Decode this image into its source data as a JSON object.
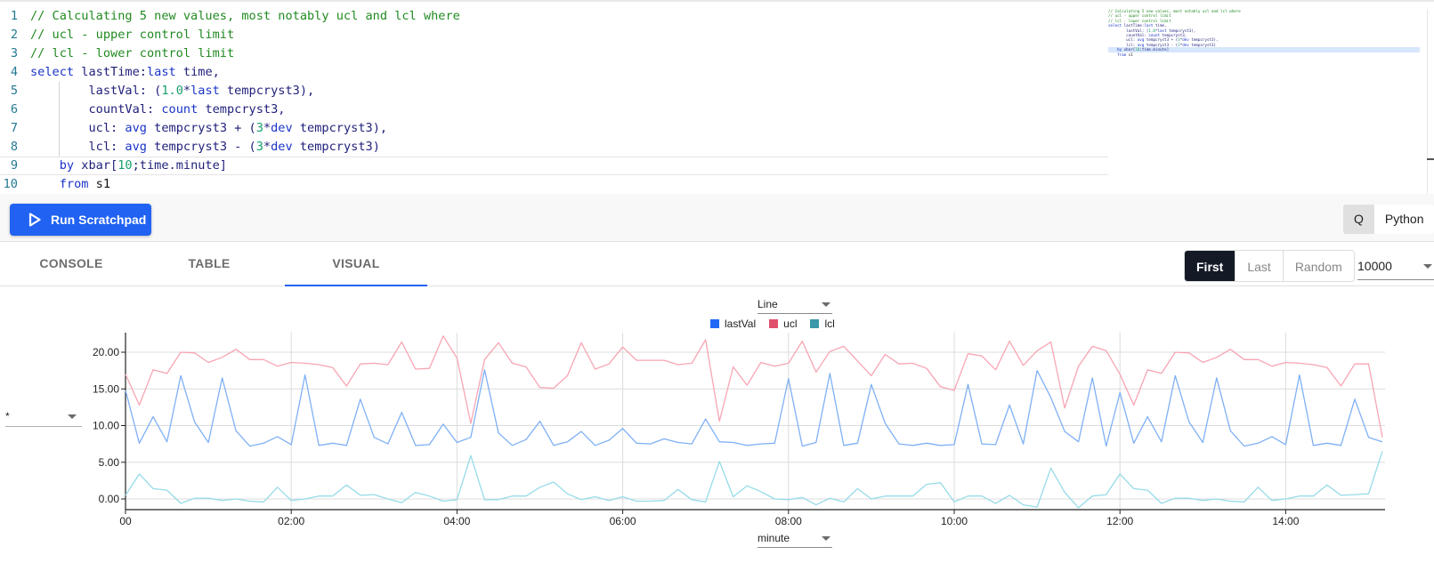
{
  "editor": {
    "lines": [
      {
        "num": "1",
        "tokens": [
          {
            "t": "// Calculating 5 new values, most notably ucl and lcl where",
            "c": "comment"
          }
        ]
      },
      {
        "num": "2",
        "tokens": [
          {
            "t": "// ucl - upper control limit",
            "c": "comment"
          }
        ]
      },
      {
        "num": "3",
        "tokens": [
          {
            "t": "// lcl - lower control limit",
            "c": "comment"
          }
        ]
      },
      {
        "num": "4",
        "tokens": [
          {
            "t": "select ",
            "c": "kw"
          },
          {
            "t": "lastTime:",
            "c": "id"
          },
          {
            "t": "last ",
            "c": "kw"
          },
          {
            "t": "time,",
            "c": "id"
          }
        ]
      },
      {
        "num": "5",
        "tokens": [
          {
            "t": "        lastVal: (",
            "c": "id"
          },
          {
            "t": "1.0",
            "c": "num"
          },
          {
            "t": "*",
            "c": "id"
          },
          {
            "t": "last ",
            "c": "kw"
          },
          {
            "t": "tempcryst3),",
            "c": "id"
          }
        ]
      },
      {
        "num": "6",
        "tokens": [
          {
            "t": "        countVal: ",
            "c": "id"
          },
          {
            "t": "count ",
            "c": "kw"
          },
          {
            "t": "tempcryst3,",
            "c": "id"
          }
        ]
      },
      {
        "num": "7",
        "tokens": [
          {
            "t": "        ucl: ",
            "c": "id"
          },
          {
            "t": "avg ",
            "c": "kw"
          },
          {
            "t": "tempcryst3 + (",
            "c": "id"
          },
          {
            "t": "3",
            "c": "num"
          },
          {
            "t": "*",
            "c": "id"
          },
          {
            "t": "dev ",
            "c": "kw"
          },
          {
            "t": "tempcryst3),",
            "c": "id"
          }
        ]
      },
      {
        "num": "8",
        "tokens": [
          {
            "t": "        lcl: ",
            "c": "id"
          },
          {
            "t": "avg ",
            "c": "kw"
          },
          {
            "t": "tempcryst3 - (",
            "c": "id"
          },
          {
            "t": "3",
            "c": "num"
          },
          {
            "t": "*",
            "c": "id"
          },
          {
            "t": "dev ",
            "c": "kw"
          },
          {
            "t": "tempcryst3)",
            "c": "id"
          }
        ]
      },
      {
        "num": "9",
        "tokens": [
          {
            "t": "    by ",
            "c": "kw"
          },
          {
            "t": "xbar[",
            "c": "id"
          },
          {
            "t": "10",
            "c": "num"
          },
          {
            "t": ";time.minute]",
            "c": "id"
          }
        ]
      },
      {
        "num": "10",
        "tokens": [
          {
            "t": "    from ",
            "c": "kw"
          },
          {
            "t": "s1",
            "c": "plain"
          }
        ]
      }
    ],
    "active_line": 9
  },
  "toolbar": {
    "run_label": "Run Scratchpad",
    "languages": [
      "Q",
      "Python"
    ],
    "selected_language": "Q"
  },
  "tabs": {
    "items": [
      "CONSOLE",
      "TABLE",
      "VISUAL"
    ],
    "active": "VISUAL"
  },
  "sampling": {
    "options": [
      "First",
      "Last",
      "Random"
    ],
    "selected": "First",
    "row_limit": "10000"
  },
  "visual": {
    "chart_type": "Line",
    "series_selector": "*",
    "x_axis_column": "minute"
  },
  "colors": {
    "accent": "#2162f2",
    "lastVal": "#2268f5",
    "ucl": "#e0506c",
    "lcl": "#3a98a8",
    "lastVal_line": "#7fb0f5",
    "ucl_line": "#f7a5b3",
    "lcl_line": "#96dbe8"
  },
  "chart_data": {
    "type": "line",
    "title": "",
    "xlabel": "minute",
    "ylabel": "",
    "x_tick_labels": [
      "00",
      "02:00",
      "04:00",
      "06:00",
      "08:00",
      "10:00",
      "12:00",
      "14:00"
    ],
    "y_tick_labels": [
      "0.00",
      "5.00",
      "10.00",
      "15.00",
      "20.00"
    ],
    "y_ticks": [
      0,
      5,
      10,
      15,
      20
    ],
    "ylim": [
      -0.8,
      23
    ],
    "x_step_minutes": 10,
    "x_start_minute": 0,
    "grid": true,
    "legend": "top-center",
    "series": [
      {
        "name": "lastVal",
        "values": [
          14.8,
          7.6,
          11.2,
          7.8,
          16.8,
          10.5,
          7.7,
          16.5,
          9.3,
          7.2,
          7.6,
          8.5,
          7.4,
          16.9,
          7.3,
          7.6,
          7.3,
          13.6,
          8.4,
          7.5,
          11.8,
          7.3,
          7.4,
          10.2,
          7.7,
          8.4,
          17.6,
          9.0,
          7.3,
          8.1,
          10.6,
          7.3,
          7.8,
          9.2,
          7.3,
          8.0,
          9.6,
          7.6,
          7.5,
          8.2,
          7.7,
          7.5,
          10.9,
          7.8,
          7.7,
          7.3,
          7.5,
          7.6,
          16.4,
          7.2,
          7.7,
          17.1,
          7.3,
          7.6,
          15.6,
          10.3,
          7.5,
          7.3,
          7.6,
          7.3,
          7.4,
          15.6,
          7.5,
          7.4,
          12.8,
          7.5,
          17.5,
          13.8,
          9.2,
          7.8,
          16.5,
          7.2,
          14.5,
          7.6,
          11.2,
          7.8,
          16.8,
          10.5,
          7.7,
          16.5,
          9.3,
          7.2,
          7.6,
          8.5,
          7.4,
          16.9,
          7.3,
          7.6,
          7.3,
          13.6,
          8.4,
          7.8
        ]
      },
      {
        "name": "ucl",
        "values": [
          17.0,
          12.8,
          17.6,
          17.1,
          20.0,
          19.9,
          18.6,
          19.3,
          20.4,
          19.0,
          19.0,
          18.1,
          18.6,
          18.5,
          18.3,
          17.9,
          15.4,
          18.4,
          18.5,
          18.3,
          21.4,
          17.7,
          17.8,
          22.2,
          19.2,
          10.3,
          19.0,
          21.3,
          18.5,
          18.0,
          15.2,
          15.1,
          16.8,
          21.3,
          17.7,
          18.4,
          20.7,
          18.9,
          18.9,
          18.9,
          18.3,
          18.5,
          21.7,
          10.6,
          18.0,
          15.5,
          18.6,
          18.1,
          18.5,
          21.5,
          17.3,
          20.1,
          20.8,
          18.8,
          16.8,
          19.7,
          18.4,
          18.5,
          17.8,
          15.3,
          14.8,
          19.8,
          19.5,
          17.6,
          21.5,
          18.2,
          20.2,
          21.4,
          12.4,
          18.1,
          20.8,
          20.2,
          17.0,
          12.8,
          17.6,
          17.1,
          20.0,
          19.9,
          18.6,
          19.3,
          20.4,
          19.0,
          19.0,
          18.1,
          18.6,
          18.5,
          18.3,
          17.9,
          15.4,
          18.4,
          18.4,
          8.4
        ]
      },
      {
        "name": "lcl",
        "values": [
          0.5,
          3.4,
          1.4,
          1.2,
          -0.6,
          0.1,
          0.1,
          -0.2,
          0.0,
          -0.3,
          -0.4,
          1.6,
          -0.2,
          0.0,
          0.4,
          0.4,
          1.9,
          0.5,
          0.6,
          0.0,
          -0.5,
          0.9,
          0.4,
          -0.3,
          -0.1,
          5.9,
          -0.1,
          -0.1,
          0.4,
          0.4,
          1.6,
          2.3,
          0.7,
          -0.1,
          0.3,
          -0.2,
          0.3,
          -0.3,
          -0.3,
          -0.2,
          1.3,
          -0.1,
          -0.4,
          5.1,
          0.3,
          1.8,
          1.0,
          0.0,
          -0.1,
          0.2,
          -0.8,
          0.1,
          -0.4,
          1.4,
          0.0,
          0.4,
          0.4,
          0.4,
          2.0,
          2.2,
          -0.4,
          0.4,
          0.4,
          -0.6,
          0.5,
          -0.8,
          -1.1,
          4.2,
          0.9,
          -1.2,
          0.4,
          0.6,
          3.4,
          1.4,
          1.2,
          -0.6,
          0.1,
          0.1,
          -0.2,
          0.0,
          -0.3,
          -0.4,
          1.6,
          -0.2,
          0.0,
          0.4,
          0.4,
          1.9,
          0.5,
          0.6,
          0.7,
          6.5
        ]
      }
    ]
  }
}
